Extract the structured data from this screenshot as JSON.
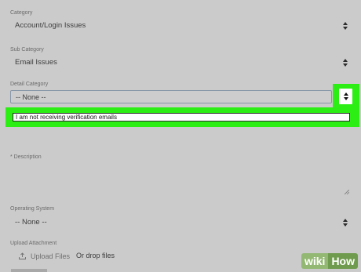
{
  "category": {
    "label": "Category",
    "value": "Account/Login Issues"
  },
  "sub_category": {
    "label": "Sub Category",
    "value": "Email Issues"
  },
  "detail_category": {
    "label": "Detail Category",
    "value": "-- None --",
    "highlighted_option": "I am not receiving verification emails"
  },
  "description": {
    "label": "* Description",
    "value": ""
  },
  "operating_system": {
    "label": "Operating System",
    "value": "-- None --"
  },
  "upload": {
    "label": "Upload Attachment",
    "button_label": "Upload Files",
    "drop_text": "Or drop files"
  },
  "watermark": {
    "part1": "wiki",
    "part2": "How"
  },
  "colors": {
    "background": "#cbcbcb",
    "highlight": "#2cee14",
    "select_border": "#8797a8"
  },
  "icons": {
    "select_arrows": "updown-arrows-icon",
    "upload": "upload-icon",
    "resize": "resize-grip-icon"
  }
}
